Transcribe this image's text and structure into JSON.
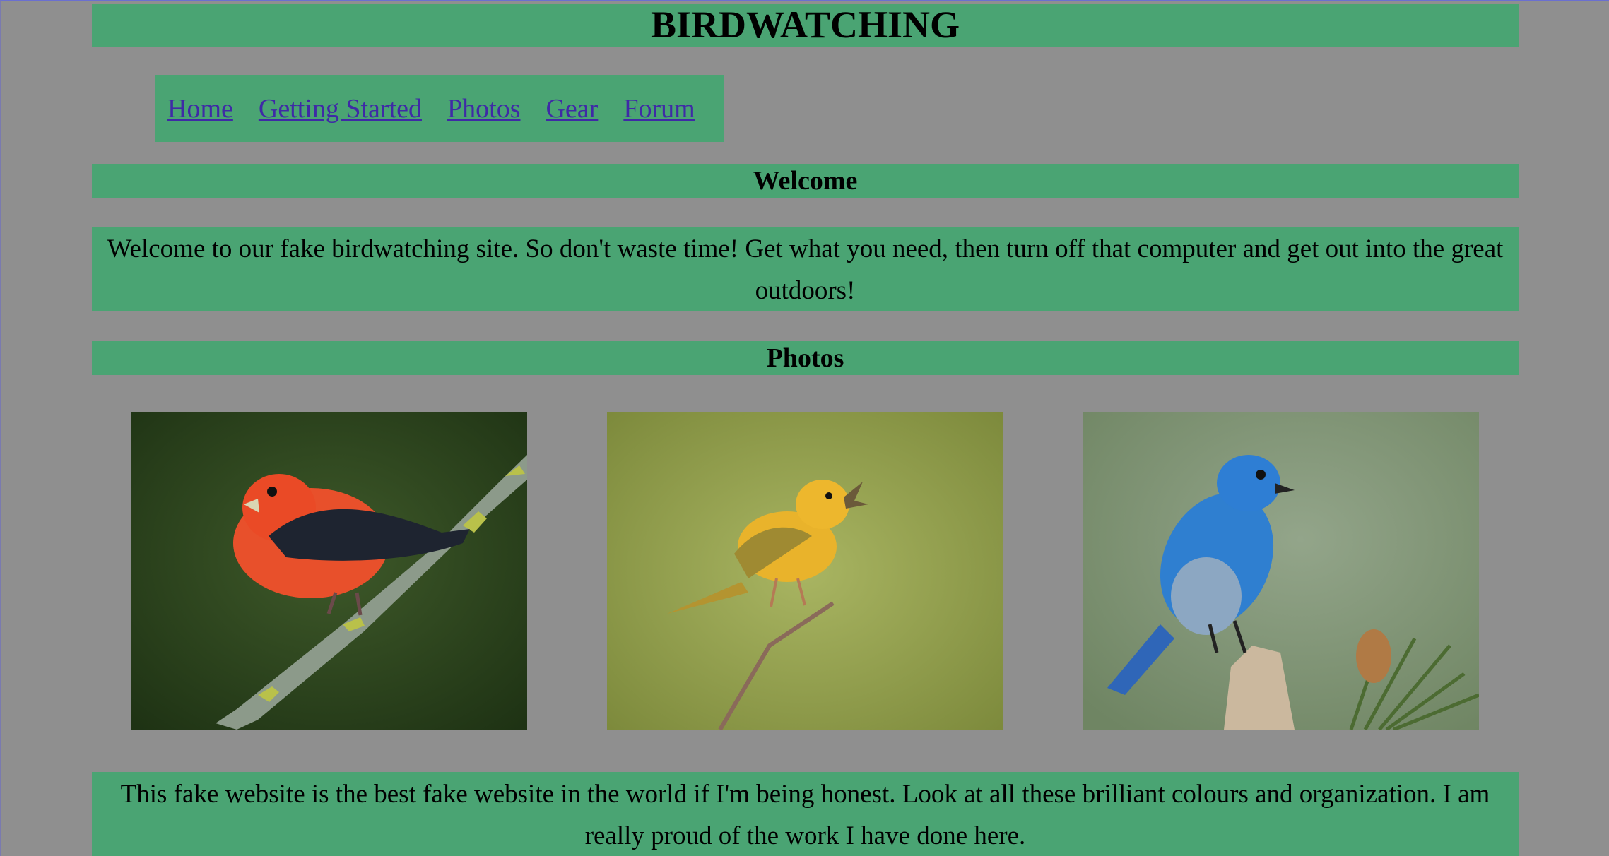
{
  "header": {
    "title": "BIRDWATCHING"
  },
  "nav": {
    "items": [
      {
        "label": "Home"
      },
      {
        "label": "Getting Started"
      },
      {
        "label": "Photos"
      },
      {
        "label": "Gear"
      },
      {
        "label": "Forum"
      }
    ]
  },
  "welcome": {
    "heading": "Welcome",
    "text": "Welcome to our fake birdwatching site. So don't waste time! Get what you need, then turn off that computer and get out into the great outdoors!"
  },
  "photos": {
    "heading": "Photos",
    "images": [
      {
        "subject": "red bird with black wings on lichen branch"
      },
      {
        "subject": "yellow bird singing on twig"
      },
      {
        "subject": "blue bird perched on stump"
      }
    ]
  },
  "footer": {
    "text": "This fake website is the best fake website in the world if I'm being honest. Look at all these brilliant colours and organization. I am really proud of the work I have done here."
  },
  "colors": {
    "page_background": "#8f8f8f",
    "band": "#4aa473",
    "link": "#3f2aa6"
  }
}
